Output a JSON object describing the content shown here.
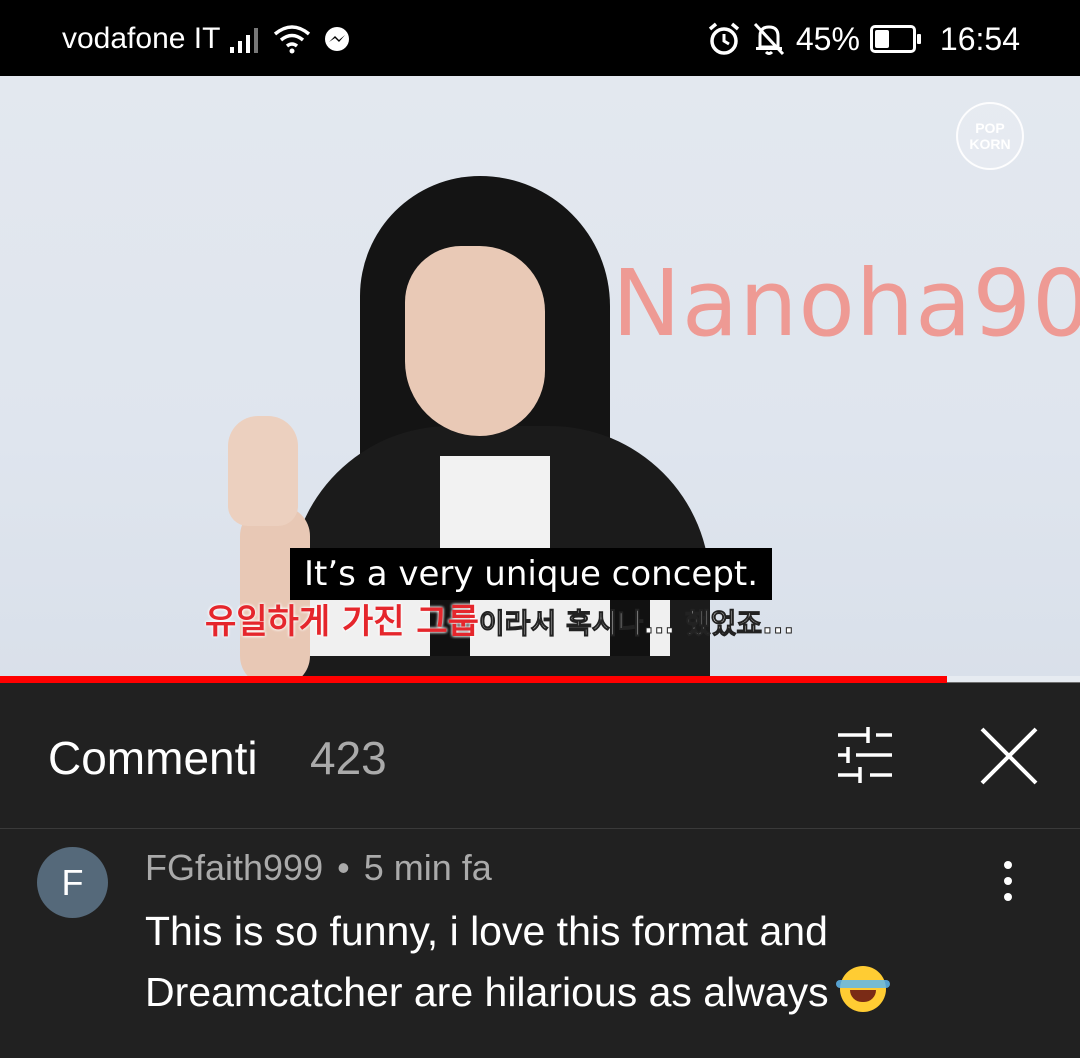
{
  "status_bar": {
    "carrier": "vodafone IT",
    "battery_percent": "45%",
    "battery_level": 0.45,
    "time": "16:54",
    "icons": [
      "signal-icon",
      "wifi-icon",
      "messenger-icon",
      "alarm-icon",
      "mute-icon",
      "battery-icon"
    ]
  },
  "video": {
    "subtitle": "It’s a very unique concept.",
    "korean_caption_red": "유일하게 가진 그룹",
    "korean_caption_white": "이라서 혹시나... 했었죠...",
    "watermark": "Nanoha90",
    "channel_logo": "POP KORN",
    "progress": 0.877
  },
  "comments": {
    "title": "Commenti",
    "count": "423",
    "items": [
      {
        "avatar_letter": "F",
        "author": "FGfaith999",
        "time": "5 min fa",
        "text": "This is so funny, i love this format and Dreamcatcher are hilarious as always",
        "emoji": "😂"
      }
    ]
  },
  "colors": {
    "progress_played": "#ff0000",
    "background": "#212121",
    "avatar": "#55697a",
    "watermark": "#ee9a94"
  }
}
